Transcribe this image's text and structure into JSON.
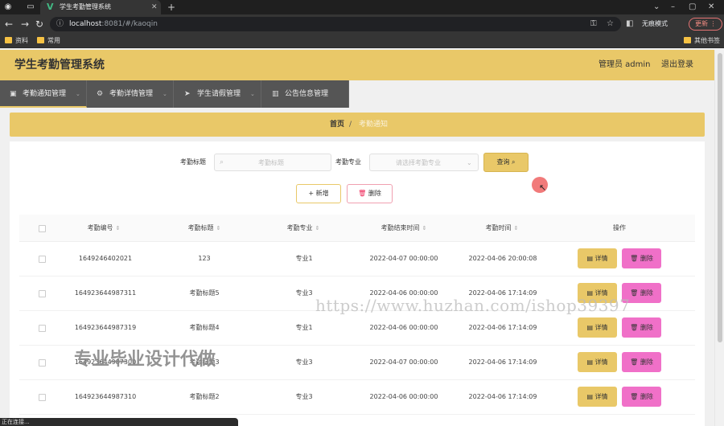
{
  "browser": {
    "tab_title": "学生考勤管理系统",
    "url_host": "localhost",
    "url_rest": ":8081/#/kaoqin",
    "incognito_label": "无痕模式",
    "update_label": "更新",
    "bookmarks": [
      "资料",
      "常用"
    ],
    "other_bookmarks": "其他书签"
  },
  "header": {
    "title": "学生考勤管理系统",
    "user_label": "管理员 admin",
    "logout_label": "退出登录"
  },
  "menu": [
    {
      "label": "考勤通知管理",
      "icon": "document-icon"
    },
    {
      "label": "考勤详情管理",
      "icon": "gear-icon"
    },
    {
      "label": "学生请假管理",
      "icon": "send-icon"
    },
    {
      "label": "公告信息管理",
      "icon": "book-icon"
    }
  ],
  "breadcrumb": {
    "home": "首页",
    "separator": "/",
    "current": "考勤通知"
  },
  "filters": {
    "title_label": "考勤标题",
    "title_placeholder": "考勤标题",
    "major_label": "考勤专业",
    "major_placeholder": "请选择考勤专业",
    "search_label": "查询"
  },
  "actions": {
    "add_label": "新增",
    "delete_label": "删除"
  },
  "table": {
    "columns": [
      "考勤编号",
      "考勤标题",
      "考勤专业",
      "考勤结束时间",
      "考勤时间",
      "操作"
    ],
    "detail_label": "详情",
    "delete_label": "删除",
    "rows": [
      {
        "id": "1649246402021",
        "title": "123",
        "major": "专业1",
        "end_time": "2022-04-07 00:00:00",
        "time": "2022-04-06 20:00:08"
      },
      {
        "id": "164923644987311",
        "title": "考勤标题5",
        "major": "专业3",
        "end_time": "2022-04-06 00:00:00",
        "time": "2022-04-06 17:14:09"
      },
      {
        "id": "164923644987319",
        "title": "考勤标题4",
        "major": "专业1",
        "end_time": "2022-04-06 00:00:00",
        "time": "2022-04-06 17:14:09"
      },
      {
        "id": "164923644987300",
        "title": "考勤标题3",
        "major": "专业3",
        "end_time": "2022-04-07 00:00:00",
        "time": "2022-04-06 17:14:09"
      },
      {
        "id": "164923644987310",
        "title": "考勤标题2",
        "major": "专业3",
        "end_time": "2022-04-06 00:00:00",
        "time": "2022-04-06 17:14:09"
      }
    ]
  },
  "overlay": {
    "watermark": "https://www.huzhan.com/ishop39397",
    "promo": "专业毕业设计代做",
    "status": "正在连接..."
  },
  "colors": {
    "accent": "#e9c868",
    "menu_bg": "#555555",
    "delete_pink": "#f070c8"
  }
}
